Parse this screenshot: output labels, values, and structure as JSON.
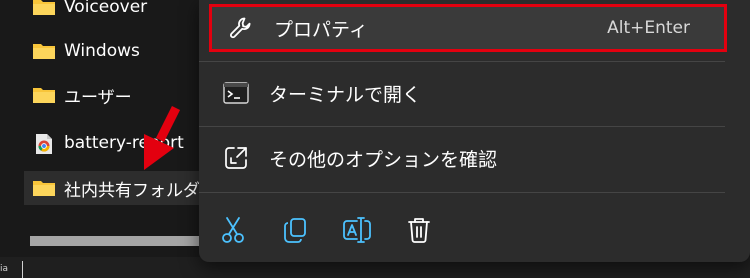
{
  "file_list": {
    "items": [
      {
        "name": "Voiceover",
        "icon": "folder-icon"
      },
      {
        "name": "Windows",
        "icon": "folder-icon"
      },
      {
        "name": "ユーザー",
        "icon": "folder-icon"
      },
      {
        "name": "battery-report",
        "icon": "chrome-html-icon"
      },
      {
        "name": "社内共有フォルダ",
        "icon": "folder-icon",
        "selected": true
      }
    ]
  },
  "status": {
    "tiny_text": "ia"
  },
  "context_menu": {
    "items": [
      {
        "label": "プロパティ",
        "shortcut": "Alt+Enter",
        "icon": "wrench-icon",
        "highlighted": true
      },
      {
        "label": "ターミナルで開く",
        "icon": "terminal-icon"
      },
      {
        "label": "その他のオプションを確認",
        "icon": "expand-icon"
      }
    ],
    "action_icons": [
      "cut-icon",
      "copy-icon",
      "rename-icon",
      "delete-icon"
    ]
  },
  "colors": {
    "highlight_border": "#e3000f",
    "arrow": "#e3000f",
    "accent_blue": "#4cc2ff",
    "folder": "#f8c53a"
  }
}
